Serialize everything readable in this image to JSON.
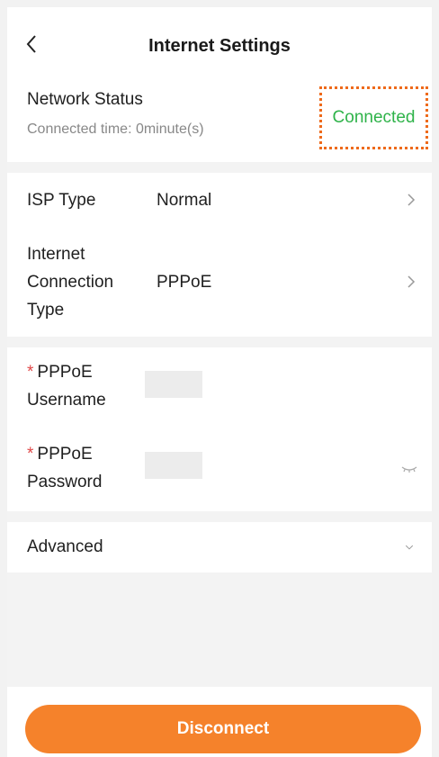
{
  "header": {
    "title": "Internet Settings",
    "network_status_label": "Network Status",
    "connected_time": "Connected time: 0minute(s)",
    "status_value": "Connected"
  },
  "isp": {
    "isp_type_label": "ISP Type",
    "isp_type_value": "Normal",
    "connection_type_label_lines": [
      "Internet",
      "Connection",
      "Type"
    ],
    "connection_type_value": "PPPoE"
  },
  "pppoe": {
    "required_marker": "*",
    "username_label_lines": [
      "PPPoE",
      "Username"
    ],
    "username_value": "",
    "password_label_lines": [
      "PPPoE",
      "Password"
    ],
    "password_value": ""
  },
  "advanced": {
    "label": "Advanced"
  },
  "footer": {
    "disconnect_label": "Disconnect"
  },
  "colors": {
    "accent": "#f5822b",
    "status_connected": "#2fb34a",
    "required": "#e04848",
    "highlight_border": "#ee6a1b"
  },
  "icons": [
    "back-chevron-icon",
    "chevron-right-icon",
    "chevron-down-icon",
    "eye-closed-icon"
  ]
}
